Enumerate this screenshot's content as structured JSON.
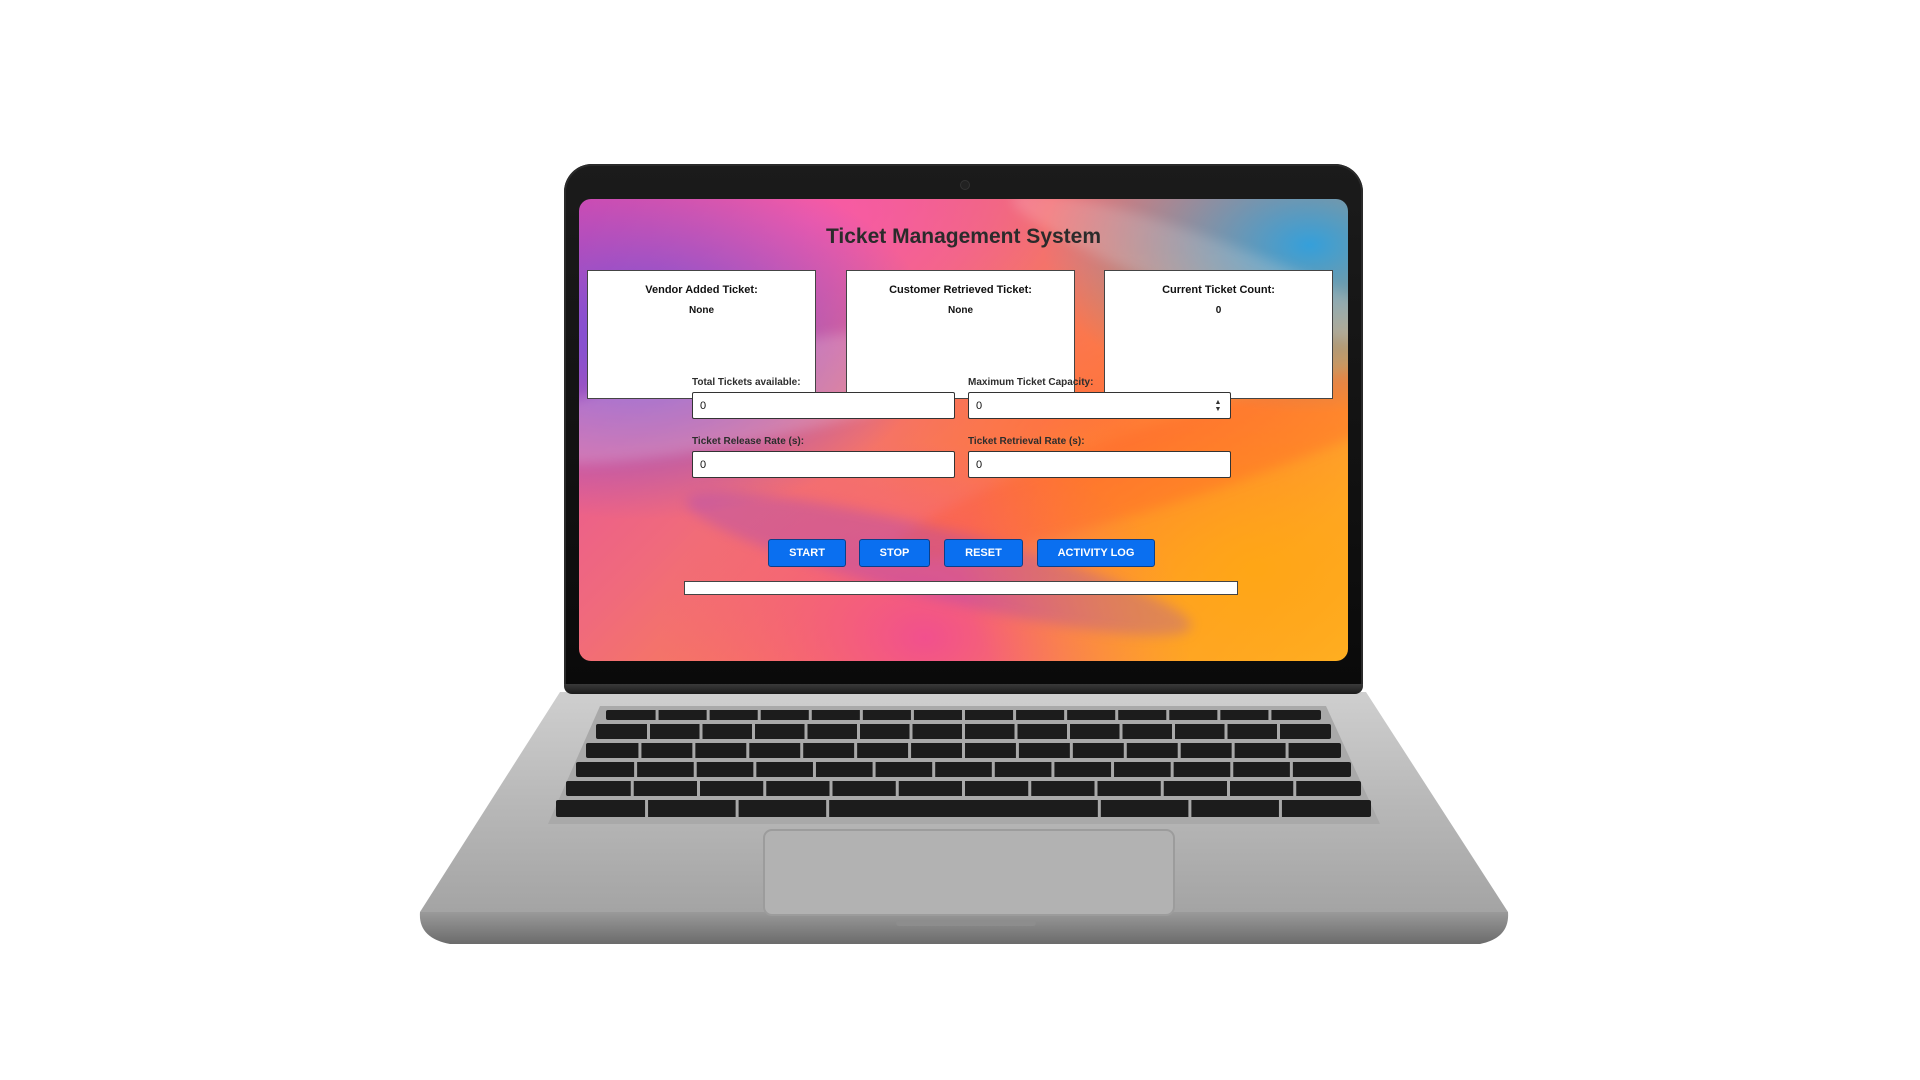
{
  "app": {
    "title": "Ticket Management System"
  },
  "panels": [
    {
      "label": "Vendor Added Ticket:",
      "value": "None"
    },
    {
      "label": "Customer Retrieved Ticket:",
      "value": "None"
    },
    {
      "label": "Current Ticket Count:",
      "value": "0"
    }
  ],
  "form": {
    "total_tickets": {
      "label": "Total Tickets available:",
      "value": "0"
    },
    "max_capacity": {
      "label": "Maximum Ticket Capacity:",
      "value": "0"
    },
    "release_rate": {
      "label": "Ticket Release Rate (s):",
      "value": "0"
    },
    "retrieval_rate": {
      "label": "Ticket Retrieval Rate (s):",
      "value": "0"
    }
  },
  "buttons": {
    "start": "START",
    "stop": "STOP",
    "reset": "RESET",
    "activity_log": "ACTIVITY LOG"
  },
  "progress": {
    "fraction": 0
  },
  "icons": {
    "spinner": "stepper-arrows-icon",
    "camera": "webcam-icon"
  },
  "colors": {
    "button": "#0a6ff0",
    "panel_bg": "#ffffff",
    "title": "#2b2b2b"
  }
}
